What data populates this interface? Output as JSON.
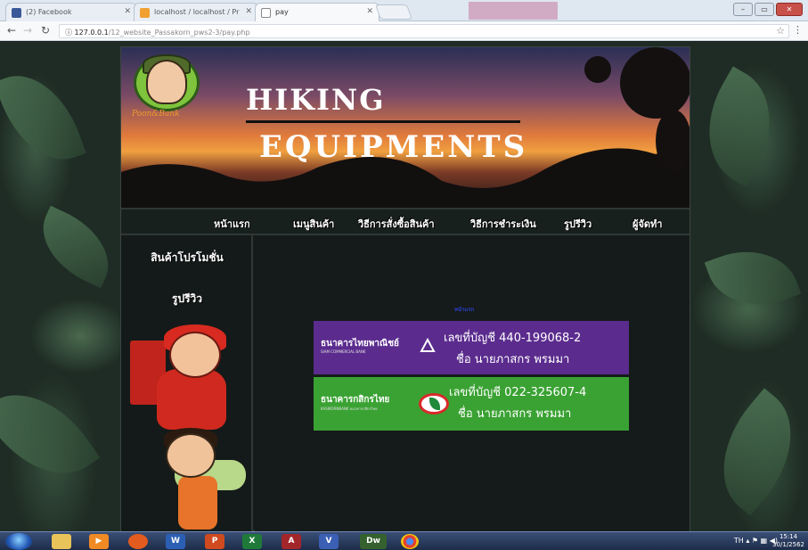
{
  "browser": {
    "tabs": [
      {
        "label": "(2) Facebook",
        "active": false
      },
      {
        "label": "localhost / localhost / Pr",
        "active": false
      },
      {
        "label": "pay",
        "active": true
      }
    ],
    "url_host": "127.0.0.1",
    "url_path": "/12_website_Passakorn_pws2-3/pay.php"
  },
  "site": {
    "logo_text": "Poon&Bank",
    "title_line1": "HIKING",
    "title_line2": "EQUIPMENTS",
    "nav": [
      "หน้าแรก",
      "เมนูสินค้า",
      "วิธีการสั่งซื้อสินค้า",
      "วิธีการชำระเงิน",
      "รูปรีวิว",
      "ผู้จัดทำ"
    ],
    "sidebar": [
      "สินค้าโปรโมชั่น",
      "รูปรีวิว"
    ],
    "content_link": "หน้าแรก",
    "banks": [
      {
        "name": "ธนาคารไทยพาณิชย์",
        "sub": "SIAM COMMERCIAL BANK",
        "account": "เลขที่บัญชี 440-199068-2",
        "holder": "ชื่อ นายภาสกร พรมมา",
        "color": "#5b2c8e"
      },
      {
        "name": "ธนาคารกสิกรไทย",
        "sub": "KASIKORNBANK ธนาคารกสิกรไทย",
        "account": "เลขที่บัญชี 022-325607-4",
        "holder": "ชื่อ นายภาสกร พรมมา",
        "color": "#3aa233"
      }
    ]
  },
  "taskbar": {
    "apps": [
      "explorer-icon",
      "media-player-icon",
      "firefox-icon",
      "word-icon",
      "powerpoint-icon",
      "excel-icon",
      "access-icon",
      "visio-icon",
      "dreamweaver-icon",
      "chrome-icon"
    ],
    "labels": {
      "word": "W",
      "powerpoint": "P",
      "excel": "X",
      "access": "A",
      "visio": "V",
      "dreamweaver": "Dw"
    },
    "language": "TH",
    "time": "15:14",
    "date": "30/1/2562"
  }
}
